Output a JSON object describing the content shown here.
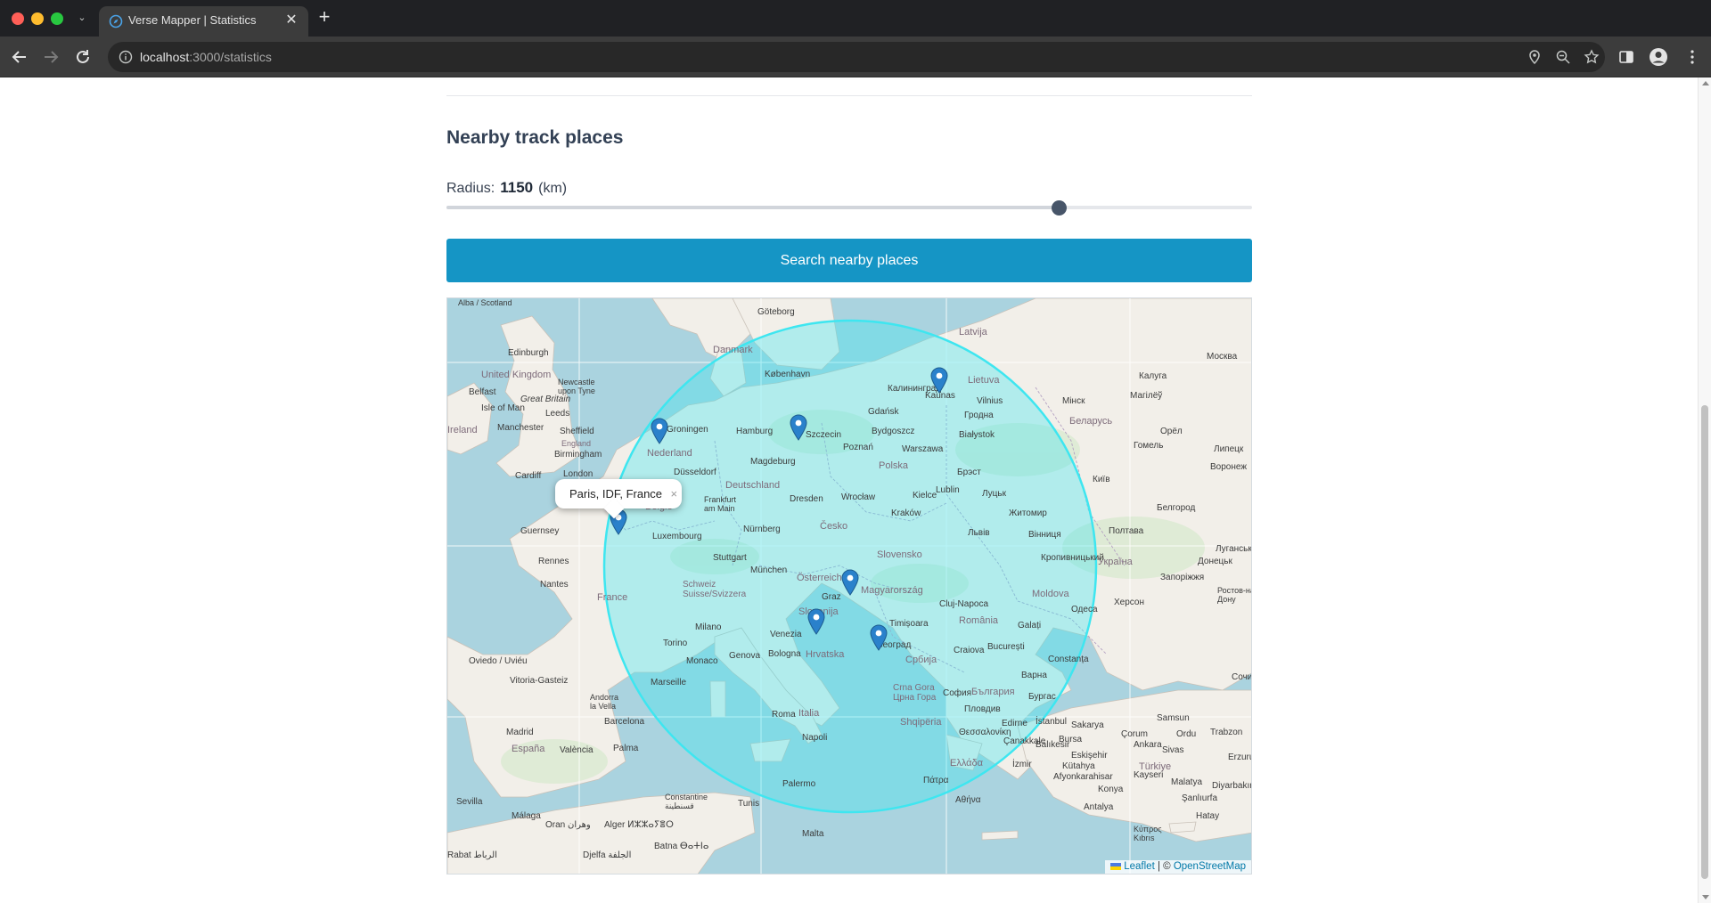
{
  "browser": {
    "tab_title": "Verse Mapper | Statistics",
    "tab_close": "✕",
    "new_tab": "+",
    "tab_menu": "⌄",
    "url_host": "localhost",
    "url_path": ":3000/statistics"
  },
  "section": {
    "title": "Nearby track places"
  },
  "radius": {
    "label": "Radius:",
    "value": "1150",
    "unit": "(km)",
    "slider_fraction": 0.76
  },
  "search_button": {
    "label": "Search nearby places"
  },
  "map": {
    "popup_text": "Paris, IDF, France",
    "popup_close": "×",
    "attribution_leaflet": "Leaflet",
    "attribution_separator": " | © ",
    "attribution_osm": "OpenStreetMap",
    "circle_color": "#3ee6f0",
    "marker_color": "#2a81cb",
    "labels": {
      "scotland": "Alba / Scotland",
      "edinburgh": "Edinburgh",
      "uk": "United Kingdom",
      "belfast": "Belfast",
      "newcastle": "Newcastle\nupon Tyne",
      "great_britain": "Great Britain",
      "isle_of_man": "Isle of Man",
      "leeds": "Leeds",
      "ireland": "Ireland",
      "manchester": "Manchester",
      "sheffield": "Sheffield",
      "england": "England",
      "birmingham": "Birmingham",
      "cardiff": "Cardiff",
      "london": "London",
      "guernsey": "Guernsey",
      "rennes": "Rennes",
      "nantes": "Nantes",
      "france": "France",
      "goteborg": "Göteborg",
      "danmark": "Danmark",
      "kobenhavn": "København",
      "latvija": "Latvija",
      "kaliningrad": "Калининград",
      "lietuva": "Lietuva",
      "vilnius": "Vilnius",
      "gdansk": "Gdańsk",
      "groningen": "Groningen",
      "hamburg": "Hamburg",
      "szczecin": "Szczecin",
      "bydgoszcz": "Bydgoszcz",
      "bialystok": "Białystok",
      "nederland": "Nederland",
      "poznan": "Poznań",
      "warszawa": "Warszawa",
      "magdeburg": "Magdeburg",
      "polska": "Polska",
      "dusseldorf": "Düsseldorf",
      "deutschland": "Deutschland",
      "lublin": "Lublin",
      "belgie": "België",
      "frankfurt": "Frankfurt\nam Main",
      "dresden": "Dresden",
      "wroclaw": "Wrocław",
      "krakow": "Kraków",
      "lviv": "Львів",
      "luxembourg": "Luxembourg",
      "nurnberg": "Nürnberg",
      "cesko": "Česko",
      "stuttgart": "Stuttgart",
      "munchen": "München",
      "osterreich": "Österreich",
      "slovensko": "Slovensko",
      "schweiz": "Schweiz\nSuisse/Svizzera",
      "graz": "Graz",
      "magyarorszag": "Magyarország",
      "cluj": "Cluj-Napoca",
      "moldova": "Moldova",
      "slovenija": "Slovenija",
      "timisoara": "Timișoara",
      "romania": "România",
      "torino": "Torino",
      "milano": "Milano",
      "venezia": "Venezia",
      "hrvatska": "Hrvatska",
      "beograd": "Београд",
      "srbija": "Србија",
      "craiova": "Craiova",
      "bucuresti": "București",
      "genova": "Genova",
      "bologna": "Bologna",
      "monaco": "Monaco",
      "marseille": "Marseille",
      "crna_gora": "Crna Gora\nЦрна Гора",
      "sofia": "София",
      "balgariya": "България",
      "varna": "Варна",
      "constanta": "Constanța",
      "italia": "Italia",
      "roma": "Roma",
      "napoli": "Napoli",
      "shqiperia": "Shqipëria",
      "plovdiv": "Пловдив",
      "burgas": "Бургас",
      "istanbul": "İstanbul",
      "andorra": "Andorra\nla Vella",
      "barcelona": "Barcelona",
      "espana": "España",
      "madrid": "Madrid",
      "valencia": "València",
      "palma": "Palma",
      "palermo": "Palermo",
      "ellada": "Ελλάδα",
      "patra": "Πάτρα",
      "athina": "Αθήνα",
      "izmir": "İzmir",
      "turkiye": "Türkiye",
      "ankara": "Ankara",
      "malta": "Malta",
      "alger": "Alger ⵍⵣⵣⴰⵢⴻⵔ",
      "constantine": "Constantine\nقسنطينة",
      "tunis": "Tunis",
      "oran": "Oran وهران",
      "batna": "Batna ⴱⴰⵜⵏⴰ",
      "djelfa": "Djelfa الجلفة",
      "rabat": "Rabat الرباط",
      "malaga": "Málaga",
      "sevilla": "Sevilla",
      "oviedo": "Oviedo / Uviéu",
      "vitoria": "Vitoria-Gasteiz",
      "belarus": "Беларусь",
      "minsk": "Мінск",
      "ukraina": "Україна",
      "kyiv": "Київ",
      "zhytomyr": "Житомир",
      "vinnytsia": "Вінниця",
      "poltava": "Полтава",
      "kropyvnytskyi": "Кропивницький",
      "odesa": "Одеса",
      "kherson": "Херсон",
      "zaporizhzhia": "Запоріжжя",
      "donetsk": "Донецьк",
      "kaluga": "Калуга",
      "moskva": "Москва",
      "oryol": "Орёл",
      "lipetsk": "Липецк",
      "voronezh": "Воронеж",
      "belgorod": "Белгород",
      "luhansk": "Луганськ",
      "rostov": "Ростов-на-\nДону",
      "samsun": "Samsun",
      "sivas": "Sivas",
      "konya": "Konya",
      "antalya": "Antalya",
      "kibris": "Κύπρος\nKıbrıs",
      "hatay": "Hatay",
      "sochi": "Сочи",
      "gomel": "Гомель",
      "mahilyou": "Магілёў",
      "hrodna": "Гродна",
      "kaunas": "Kaunas",
      "brest": "Брэст",
      "lutsk": "Луцьк",
      "galati": "Galați",
      "kielce": "Kielce",
      "ordu": "Ordu",
      "trabzon": "Trabzon",
      "erzurum": "Erzurum",
      "malatya": "Malatya",
      "diyarbakir": "Diyarbakır",
      "kayseri": "Kayseri",
      "corum": "Çorum",
      "eskisehir": "Eskişehir",
      "bursa": "Bursa",
      "balikesir": "Balıkesir",
      "afyon": "Afyonkarahisar",
      "kutahya": "Kütahya",
      "sakarya": "Sakarya",
      "canakkale": "Çanakkale",
      "edirne": "Edirne",
      "sanliurfa": "Şanlıurfa",
      "thessaloniki": "Θεσσαλονίκη"
    }
  }
}
